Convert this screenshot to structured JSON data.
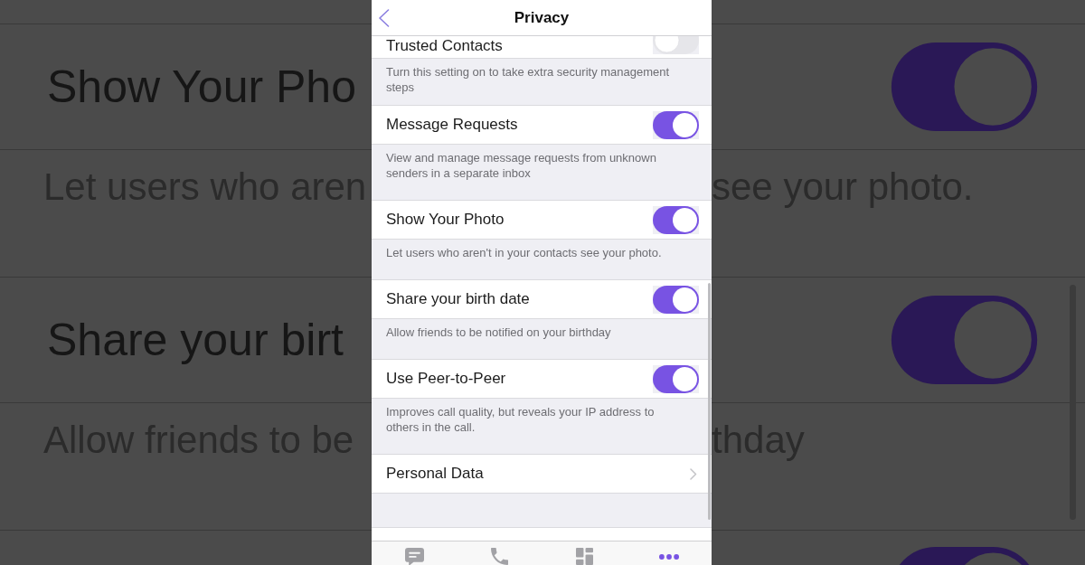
{
  "header": {
    "title": "Privacy"
  },
  "settings": [
    {
      "kind": "toggle",
      "label": "Trusted Contacts",
      "on": false,
      "description": "Turn this setting on to take extra security management steps"
    },
    {
      "kind": "toggle",
      "label": "Message Requests",
      "on": true,
      "description": "View and manage message requests from unknown senders in a separate inbox"
    },
    {
      "kind": "toggle",
      "label": "Show Your Photo",
      "on": true,
      "description": "Let users who aren't in your contacts see your photo."
    },
    {
      "kind": "toggle",
      "label": "Share your birth date",
      "on": true,
      "description": "Allow friends to be notified on your birthday"
    },
    {
      "kind": "toggle",
      "label": "Use Peer-to-Peer",
      "on": true,
      "description": "Improves call quality, but reveals your IP address to others in the call."
    },
    {
      "kind": "link",
      "label": "Personal Data"
    }
  ],
  "tab_bar": [
    {
      "selected": false
    },
    {
      "selected": false
    },
    {
      "selected": false
    },
    {
      "selected": true
    }
  ],
  "backdrop": {
    "rows": [
      {
        "kind": "setting",
        "title": "Show Your Pho",
        "on": true
      },
      {
        "kind": "note",
        "left": "Let users who aren",
        "right": "see your photo."
      },
      {
        "kind": "setting",
        "title": "Share your birt",
        "on": true
      },
      {
        "kind": "note",
        "left": "Allow friends to be",
        "right": "thday"
      },
      {
        "kind": "setting",
        "on": true
      }
    ]
  }
}
